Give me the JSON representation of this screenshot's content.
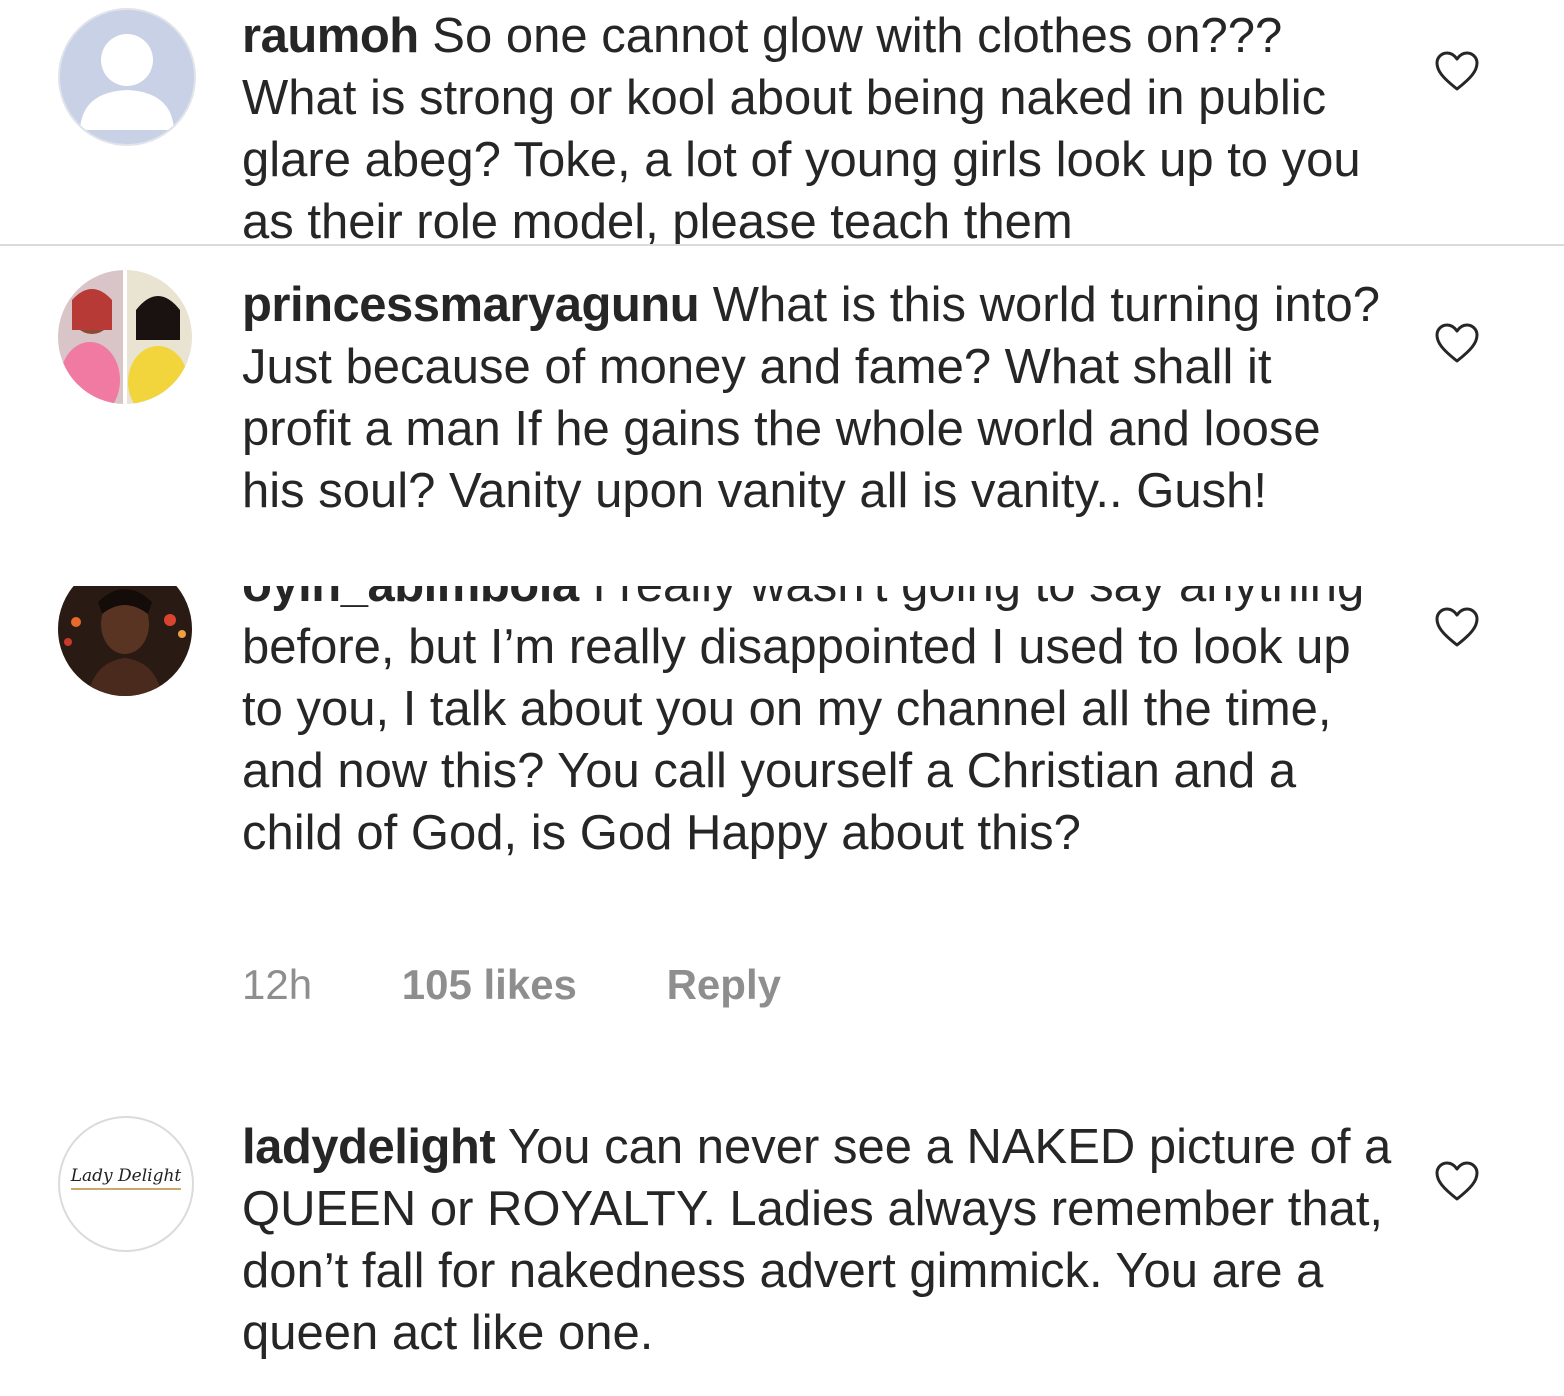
{
  "comments": [
    {
      "username": "raumoh",
      "text": " So one cannot glow with clothes on??? What is strong or kool about being naked in public glare abeg? Toke, a lot of young girls look up to you as their role model, please teach them",
      "avatar_icon": "default-profile-icon"
    },
    {
      "username": "princessmaryagunu",
      "text": " What is this world turning into? Just because of money and fame? What shall it profit a man If he gains the whole world and loose his soul? Vanity upon vanity all is vanity.. Gush!",
      "avatar_icon": "profile-photo-collage"
    },
    {
      "username": "oyin_abimbola",
      "text": " I really wasn't going to say anything before, but I’m really disappointed I used to look up to you, I talk about you on my channel all the time, and now this? You call yourself a Christian and a child of God, is God Happy about this?",
      "time": "12h",
      "likes": "105 likes",
      "reply": "Reply",
      "avatar_icon": "profile-photo-portrait"
    },
    {
      "username": "ladydelight",
      "text": " You can never see a NAKED picture of a QUEEN or ROYALTY. Ladies always remember that, don’t fall for nakedness advert gimmick. You are a queen act like one.",
      "avatar_text": "Lady Delight"
    }
  ],
  "colors": {
    "text": "#262626",
    "meta": "#8e8e8e",
    "divider": "#dbdbdb",
    "heart_stroke": "#262626"
  }
}
